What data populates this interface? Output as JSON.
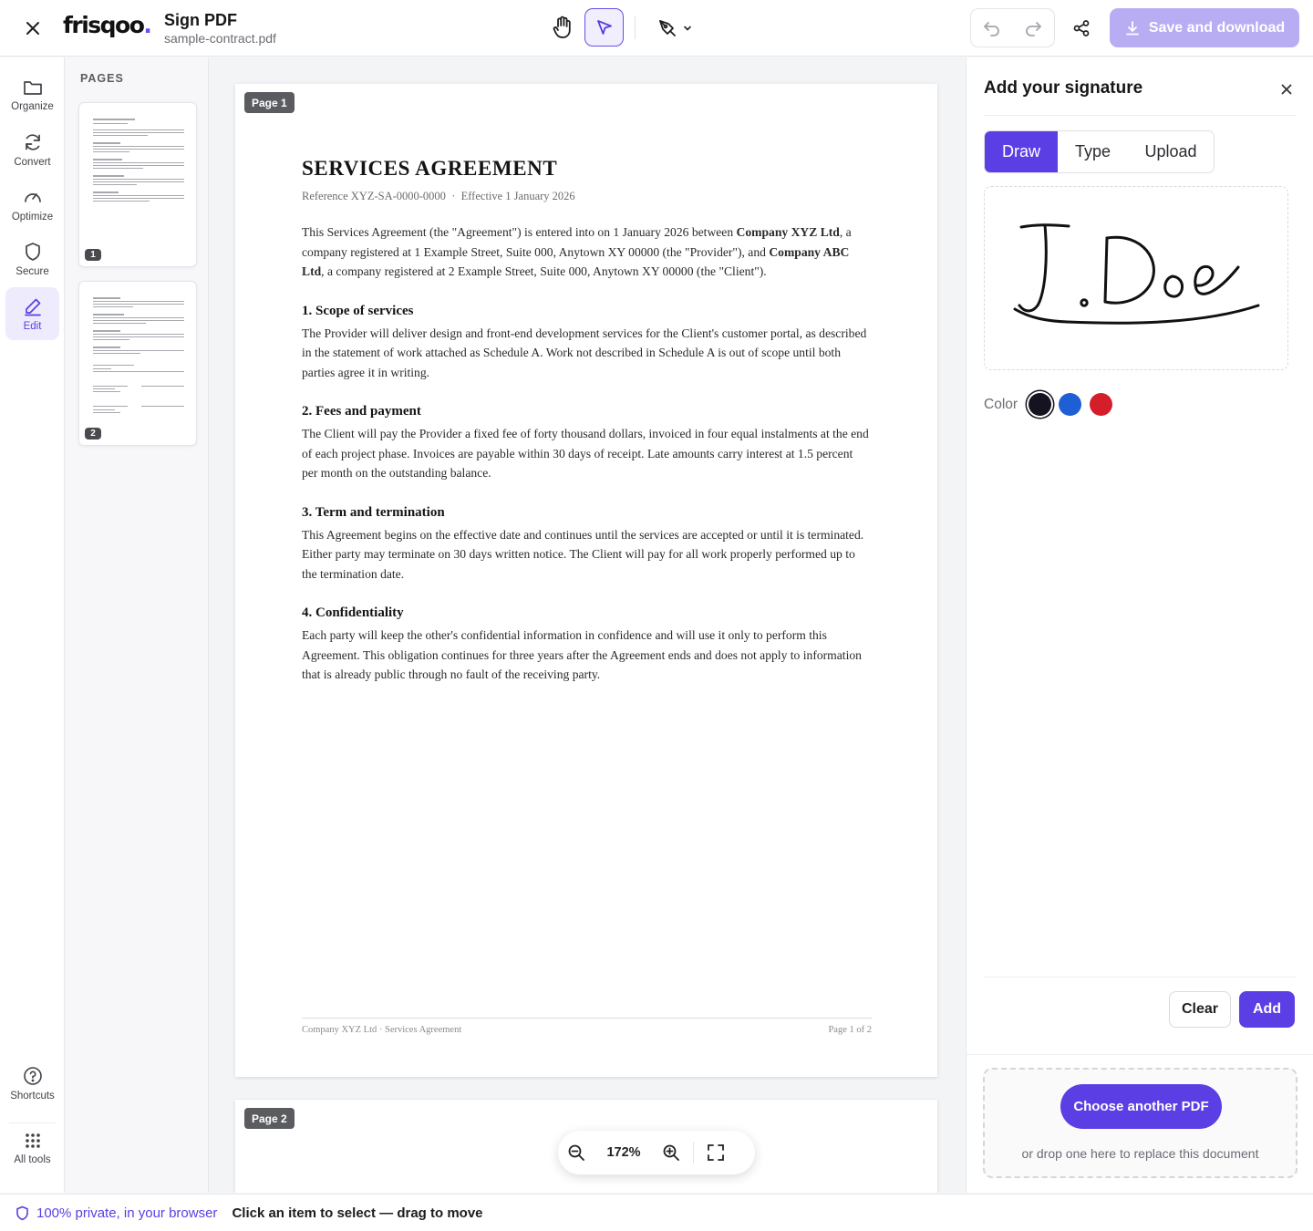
{
  "app": {
    "logo_main": "frisqoo",
    "logo_dot": ".",
    "tool_title": "Sign PDF",
    "filename": "sample-contract.pdf",
    "save_label": "Save and download"
  },
  "rail": {
    "items": [
      {
        "label": "Organize",
        "icon": "folder-icon"
      },
      {
        "label": "Convert",
        "icon": "refresh-icon"
      },
      {
        "label": "Optimize",
        "icon": "gauge-icon"
      },
      {
        "label": "Secure",
        "icon": "shield-icon"
      },
      {
        "label": "Edit",
        "icon": "pen-icon",
        "active": true
      }
    ],
    "bottom": [
      {
        "label": "Shortcuts",
        "icon": "help-circle-icon"
      },
      {
        "label": "All tools",
        "icon": "grid-dots-icon"
      }
    ]
  },
  "pages_panel": {
    "title": "PAGES",
    "thumbs": [
      {
        "num": "1"
      },
      {
        "num": "2"
      }
    ]
  },
  "document": {
    "page1_tag": "Page 1",
    "page2_tag": "Page 2",
    "title": "SERVICES AGREEMENT",
    "reference": "Reference XYZ-SA-0000-0000",
    "ref_sep": "·",
    "effective": "Effective 1 January 2026",
    "intro": {
      "t1": "This Services Agreement (the \"Agreement\") is entered into on 1 January 2026 between ",
      "b1": "Company XYZ Ltd",
      "t2": ", a company registered at 1 Example Street, Suite 000, Anytown XY 00000 (the \"Provider\"), and ",
      "b2": "Company ABC Ltd",
      "t3": ", a company registered at 2 Example Street, Suite 000, Anytown XY 00000 (the \"Client\")."
    },
    "sections": [
      {
        "heading": "1. Scope of services",
        "body": "The Provider will deliver design and front-end development services for the Client's customer portal, as described in the statement of work attached as Schedule A. Work not described in Schedule A is out of scope until both parties agree it in writing."
      },
      {
        "heading": "2. Fees and payment",
        "body": "The Client will pay the Provider a fixed fee of forty thousand dollars, invoiced in four equal instalments at the end of each project phase. Invoices are payable within 30 days of receipt. Late amounts carry interest at 1.5 percent per month on the outstanding balance."
      },
      {
        "heading": "3. Term and termination",
        "body": "This Agreement begins on the effective date and continues until the services are accepted or until it is terminated. Either party may terminate on 30 days written notice. The Client will pay for all work properly performed up to the termination date."
      },
      {
        "heading": "4. Confidentiality",
        "body": "Each party will keep the other's confidential information in confidence and will use it only to perform this Agreement. This obligation continues for three years after the Agreement ends and does not apply to information that is already public through no fault of the receiving party."
      }
    ],
    "footer_left": "Company XYZ Ltd · Services Agreement",
    "footer_right": "Page 1 of 2"
  },
  "zoom": {
    "value": "172%"
  },
  "signature_panel": {
    "title": "Add your signature",
    "tabs": {
      "draw": "Draw",
      "type": "Type",
      "upload": "Upload"
    },
    "active_tab": "Draw",
    "color_label": "Color",
    "colors": [
      "#15131f",
      "#1e5fd6",
      "#d41f2a"
    ],
    "selected_color": "#15131f",
    "clear_label": "Clear",
    "add_label": "Add",
    "choose_label": "Choose another PDF",
    "drop_hint": "or drop one here to replace this document"
  },
  "status": {
    "private": "100% private, in your browser",
    "hint": "Click an item to select — drag to move"
  },
  "colors": {
    "accent": "#5b3fe4",
    "accent_light": "#b8adf3"
  }
}
